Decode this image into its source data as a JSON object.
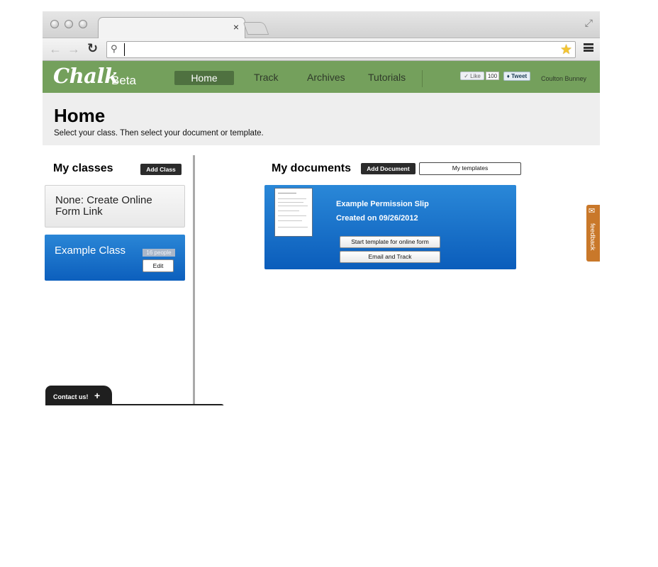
{
  "browser": {
    "tab_close": "×",
    "search_placeholder": "",
    "address_value": ""
  },
  "header": {
    "logo": "Chalk",
    "logo_suffix": "Beta",
    "nav": [
      {
        "label": "Home",
        "active": true
      },
      {
        "label": "Track"
      },
      {
        "label": "Archives"
      },
      {
        "label": "Tutorials"
      }
    ],
    "social": {
      "like_label": "✓ Like",
      "like_count": "100",
      "tweet_label": "Tweet"
    },
    "username": "Coulton Bunney"
  },
  "page": {
    "title": "Home",
    "subtitle": "Select your class. Then select your document or template."
  },
  "classes": {
    "heading": "My classes",
    "add_button": "Add Class",
    "items": [
      {
        "name": "None: Create Online Form Link"
      },
      {
        "name": "Example Class",
        "people": "16 people",
        "edit_label": "Edit",
        "selected": true
      }
    ]
  },
  "documents": {
    "heading": "My documents",
    "add_button": "Add Document",
    "templates_button": "My templates",
    "items": [
      {
        "title": "Example Permission Slip",
        "created": "Created on 09/26/2012",
        "primary_action": "Start template for online form",
        "secondary_action": "Email and Track"
      }
    ]
  },
  "feedback_tab": {
    "label": "feedback"
  },
  "contact": {
    "label": "Contact us!",
    "plus": "+"
  },
  "colors": {
    "header_green": "#74a05c",
    "nav_active": "#4f7140",
    "card_blue": "#0b5dbb",
    "feedback_orange": "#c9782a"
  },
  "icons": [
    "search-icon",
    "star-icon",
    "menu-icon",
    "back-arrow-icon",
    "forward-arrow-icon",
    "reload-icon",
    "fullscreen-icon",
    "feedback-megaphone-icon",
    "plus-icon",
    "twitter-icon"
  ]
}
